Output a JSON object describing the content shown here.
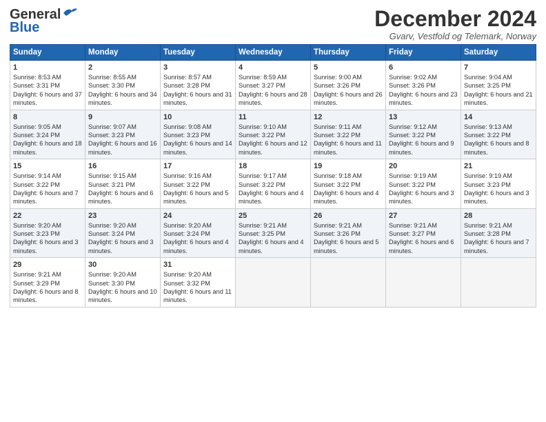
{
  "header": {
    "logo_line1": "General",
    "logo_line2": "Blue",
    "title": "December 2024",
    "subtitle": "Gvarv, Vestfold og Telemark, Norway"
  },
  "days_of_week": [
    "Sunday",
    "Monday",
    "Tuesday",
    "Wednesday",
    "Thursday",
    "Friday",
    "Saturday"
  ],
  "weeks": [
    [
      {
        "day": 1,
        "sunrise": "Sunrise: 8:53 AM",
        "sunset": "Sunset: 3:31 PM",
        "daylight": "Daylight: 6 hours and 37 minutes."
      },
      {
        "day": 2,
        "sunrise": "Sunrise: 8:55 AM",
        "sunset": "Sunset: 3:30 PM",
        "daylight": "Daylight: 6 hours and 34 minutes."
      },
      {
        "day": 3,
        "sunrise": "Sunrise: 8:57 AM",
        "sunset": "Sunset: 3:28 PM",
        "daylight": "Daylight: 6 hours and 31 minutes."
      },
      {
        "day": 4,
        "sunrise": "Sunrise: 8:59 AM",
        "sunset": "Sunset: 3:27 PM",
        "daylight": "Daylight: 6 hours and 28 minutes."
      },
      {
        "day": 5,
        "sunrise": "Sunrise: 9:00 AM",
        "sunset": "Sunset: 3:26 PM",
        "daylight": "Daylight: 6 hours and 26 minutes."
      },
      {
        "day": 6,
        "sunrise": "Sunrise: 9:02 AM",
        "sunset": "Sunset: 3:26 PM",
        "daylight": "Daylight: 6 hours and 23 minutes."
      },
      {
        "day": 7,
        "sunrise": "Sunrise: 9:04 AM",
        "sunset": "Sunset: 3:25 PM",
        "daylight": "Daylight: 6 hours and 21 minutes."
      }
    ],
    [
      {
        "day": 8,
        "sunrise": "Sunrise: 9:05 AM",
        "sunset": "Sunset: 3:24 PM",
        "daylight": "Daylight: 6 hours and 18 minutes."
      },
      {
        "day": 9,
        "sunrise": "Sunrise: 9:07 AM",
        "sunset": "Sunset: 3:23 PM",
        "daylight": "Daylight: 6 hours and 16 minutes."
      },
      {
        "day": 10,
        "sunrise": "Sunrise: 9:08 AM",
        "sunset": "Sunset: 3:23 PM",
        "daylight": "Daylight: 6 hours and 14 minutes."
      },
      {
        "day": 11,
        "sunrise": "Sunrise: 9:10 AM",
        "sunset": "Sunset: 3:22 PM",
        "daylight": "Daylight: 6 hours and 12 minutes."
      },
      {
        "day": 12,
        "sunrise": "Sunrise: 9:11 AM",
        "sunset": "Sunset: 3:22 PM",
        "daylight": "Daylight: 6 hours and 11 minutes."
      },
      {
        "day": 13,
        "sunrise": "Sunrise: 9:12 AM",
        "sunset": "Sunset: 3:22 PM",
        "daylight": "Daylight: 6 hours and 9 minutes."
      },
      {
        "day": 14,
        "sunrise": "Sunrise: 9:13 AM",
        "sunset": "Sunset: 3:22 PM",
        "daylight": "Daylight: 6 hours and 8 minutes."
      }
    ],
    [
      {
        "day": 15,
        "sunrise": "Sunrise: 9:14 AM",
        "sunset": "Sunset: 3:22 PM",
        "daylight": "Daylight: 6 hours and 7 minutes."
      },
      {
        "day": 16,
        "sunrise": "Sunrise: 9:15 AM",
        "sunset": "Sunset: 3:21 PM",
        "daylight": "Daylight: 6 hours and 6 minutes."
      },
      {
        "day": 17,
        "sunrise": "Sunrise: 9:16 AM",
        "sunset": "Sunset: 3:22 PM",
        "daylight": "Daylight: 6 hours and 5 minutes."
      },
      {
        "day": 18,
        "sunrise": "Sunrise: 9:17 AM",
        "sunset": "Sunset: 3:22 PM",
        "daylight": "Daylight: 6 hours and 4 minutes."
      },
      {
        "day": 19,
        "sunrise": "Sunrise: 9:18 AM",
        "sunset": "Sunset: 3:22 PM",
        "daylight": "Daylight: 6 hours and 4 minutes."
      },
      {
        "day": 20,
        "sunrise": "Sunrise: 9:19 AM",
        "sunset": "Sunset: 3:22 PM",
        "daylight": "Daylight: 6 hours and 3 minutes."
      },
      {
        "day": 21,
        "sunrise": "Sunrise: 9:19 AM",
        "sunset": "Sunset: 3:23 PM",
        "daylight": "Daylight: 6 hours and 3 minutes."
      }
    ],
    [
      {
        "day": 22,
        "sunrise": "Sunrise: 9:20 AM",
        "sunset": "Sunset: 3:23 PM",
        "daylight": "Daylight: 6 hours and 3 minutes."
      },
      {
        "day": 23,
        "sunrise": "Sunrise: 9:20 AM",
        "sunset": "Sunset: 3:24 PM",
        "daylight": "Daylight: 6 hours and 3 minutes."
      },
      {
        "day": 24,
        "sunrise": "Sunrise: 9:20 AM",
        "sunset": "Sunset: 3:24 PM",
        "daylight": "Daylight: 6 hours and 4 minutes."
      },
      {
        "day": 25,
        "sunrise": "Sunrise: 9:21 AM",
        "sunset": "Sunset: 3:25 PM",
        "daylight": "Daylight: 6 hours and 4 minutes."
      },
      {
        "day": 26,
        "sunrise": "Sunrise: 9:21 AM",
        "sunset": "Sunset: 3:26 PM",
        "daylight": "Daylight: 6 hours and 5 minutes."
      },
      {
        "day": 27,
        "sunrise": "Sunrise: 9:21 AM",
        "sunset": "Sunset: 3:27 PM",
        "daylight": "Daylight: 6 hours and 6 minutes."
      },
      {
        "day": 28,
        "sunrise": "Sunrise: 9:21 AM",
        "sunset": "Sunset: 3:28 PM",
        "daylight": "Daylight: 6 hours and 7 minutes."
      }
    ],
    [
      {
        "day": 29,
        "sunrise": "Sunrise: 9:21 AM",
        "sunset": "Sunset: 3:29 PM",
        "daylight": "Daylight: 6 hours and 8 minutes."
      },
      {
        "day": 30,
        "sunrise": "Sunrise: 9:20 AM",
        "sunset": "Sunset: 3:30 PM",
        "daylight": "Daylight: 6 hours and 10 minutes."
      },
      {
        "day": 31,
        "sunrise": "Sunrise: 9:20 AM",
        "sunset": "Sunset: 3:32 PM",
        "daylight": "Daylight: 6 hours and 11 minutes."
      },
      null,
      null,
      null,
      null
    ]
  ]
}
